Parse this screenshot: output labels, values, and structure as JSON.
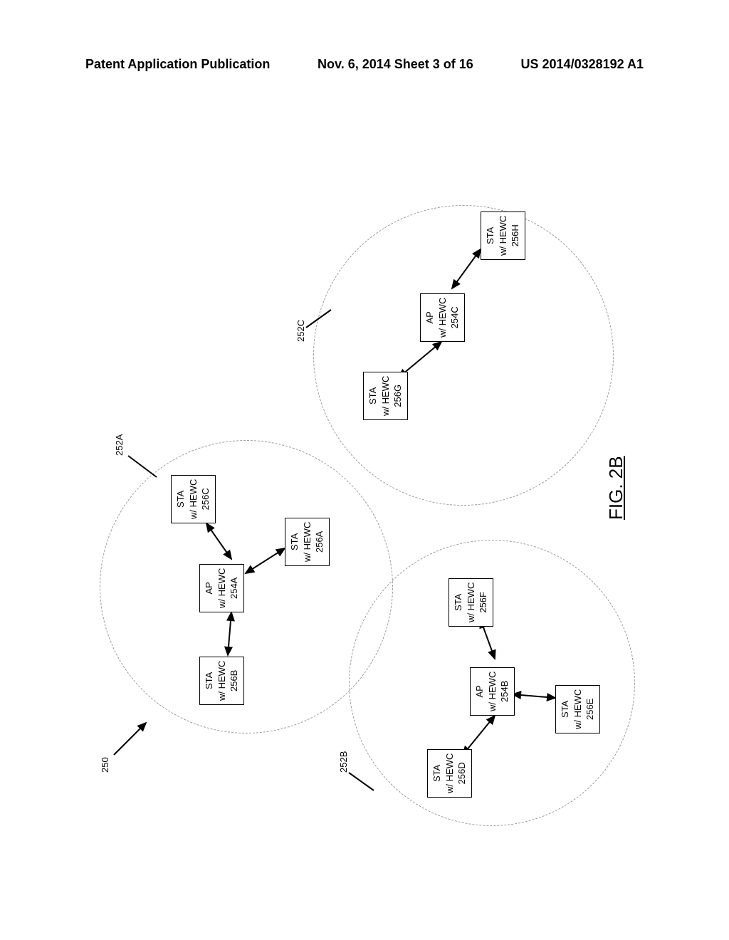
{
  "header": {
    "left": "Patent Application Publication",
    "mid": "Nov. 6, 2014   Sheet 3 of 16",
    "right": "US 2014/0328192 A1"
  },
  "labels": {
    "system": "250",
    "cellA": "252A",
    "cellB": "252B",
    "cellC": "252C",
    "fig": "FIG. 2B"
  },
  "nodes": {
    "ap_a": {
      "l1": "AP",
      "l2": "w/ HEWC",
      "l3": "254A"
    },
    "ap_b": {
      "l1": "AP",
      "l2": "w/ HEWC",
      "l3": "254B"
    },
    "ap_c": {
      "l1": "AP",
      "l2": "w/ HEWC",
      "l3": "254C"
    },
    "sta_a": {
      "l1": "STA",
      "l2": "w/ HEWC",
      "l3": "256A"
    },
    "sta_b": {
      "l1": "STA",
      "l2": "w/ HEWC",
      "l3": "256B"
    },
    "sta_c": {
      "l1": "STA",
      "l2": "w/ HEWC",
      "l3": "256C"
    },
    "sta_d": {
      "l1": "STA",
      "l2": "w/ HEWC",
      "l3": "256D"
    },
    "sta_e": {
      "l1": "STA",
      "l2": "w/ HEWC",
      "l3": "256E"
    },
    "sta_f": {
      "l1": "STA",
      "l2": "w/ HEWC",
      "l3": "256F"
    },
    "sta_g": {
      "l1": "STA",
      "l2": "w/ HEWC",
      "l3": "256G"
    },
    "sta_h": {
      "l1": "STA",
      "l2": "w/ HEWC",
      "l3": "256H"
    }
  }
}
